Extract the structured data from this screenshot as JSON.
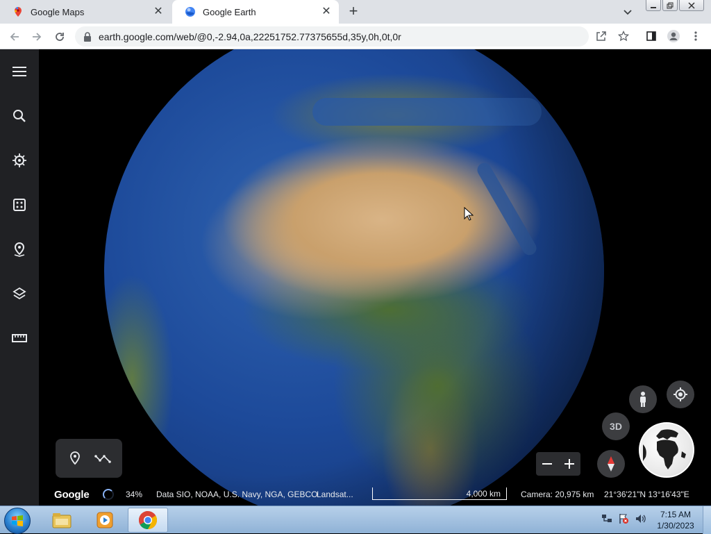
{
  "browser": {
    "tabs": [
      {
        "title": "Google Maps",
        "icon": "google-maps-icon",
        "active": false
      },
      {
        "title": "Google Earth",
        "icon": "google-earth-icon",
        "active": true
      }
    ],
    "url": "earth.google.com/web/@0,-2.94,0a,22251752.77375655d,35y,0h,0t,0r"
  },
  "earth": {
    "sidebar": [
      "menu-icon",
      "search-icon",
      "voyager-icon",
      "feeling-lucky-icon",
      "projects-icon",
      "map-style-icon",
      "measure-icon"
    ],
    "view_3d_label": "3D",
    "status": {
      "logo": "Google",
      "load_percent": "34%",
      "attribution": "Data SIO, NOAA, U.S. Navy, NGA, GEBCO",
      "attribution_more": "Landsat...",
      "scale_label": "4,000 km",
      "camera": "Camera: 20,975 km",
      "coordinates": "21°36'21\"N 13°16'43\"E"
    }
  },
  "taskbar": {
    "apps": [
      "windows-explorer-icon",
      "media-player-icon",
      "chrome-icon"
    ],
    "time": "7:15 AM",
    "date": "1/30/2023"
  },
  "colors": {
    "sidebar_bg": "#202124",
    "accent_blue": "#8ab4f8",
    "tab_strip": "#dee1e6"
  }
}
